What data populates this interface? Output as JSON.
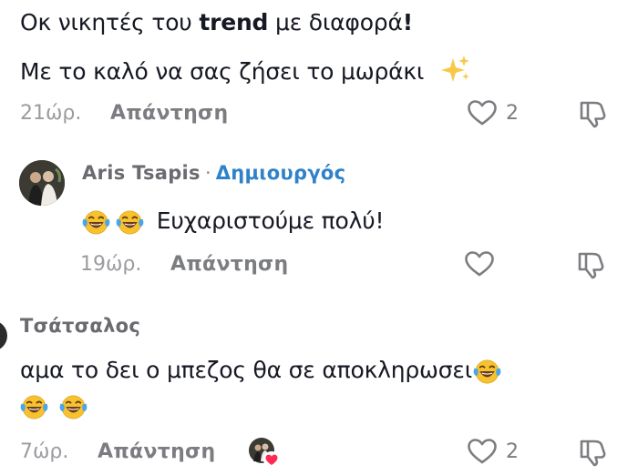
{
  "comment1": {
    "line1_prefix": "Οκ νικητές του ",
    "line1_bold": "trend",
    "line1_suffix": " με διαφορά",
    "line1_excl": "!",
    "line2": "Με το καλό να σας ζήσει το μωράκι",
    "time": "21ώρ.",
    "reply_label": "Απάντηση",
    "likes": "2"
  },
  "comment2": {
    "author": "Aris Tsapis",
    "separator": "·",
    "creator_badge": "Δημιουργός",
    "text": "Ευχαριστούμε πολύ!",
    "time": "19ώρ.",
    "reply_label": "Απάντηση"
  },
  "comment3": {
    "author": "Τσάτσαλος",
    "text": "αμα το δει ο μπεζος θα σε αποκληρωσει",
    "time": "7ώρ.",
    "reply_label": "Απάντηση",
    "likes": "2"
  },
  "colors": {
    "creator_blue": "#2f82c9",
    "liked_by_creator_heart": "#fe2c55",
    "emoji_yellow": "#f7c22e",
    "tear_blue": "#4aa6e8"
  },
  "icons": [
    "sparkles-icon",
    "heart-icon",
    "thumbs-down-icon",
    "laughing-tears-emoji"
  ]
}
